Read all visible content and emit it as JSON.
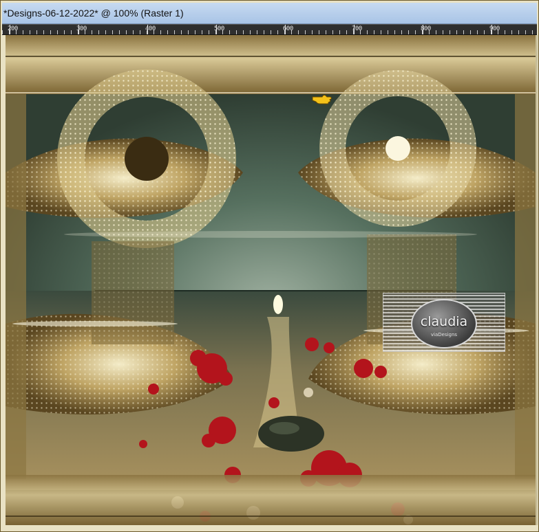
{
  "window": {
    "title": "*Designs-06-12-2022* @ 100% (Raster 1)"
  },
  "ruler": {
    "labels": [
      "200",
      "300",
      "400",
      "500",
      "600",
      "700",
      "800",
      "900"
    ]
  },
  "watermark": {
    "name": "claudia",
    "subtitle": "viaDesigns"
  },
  "colors": {
    "title_bar": "#b8d0ee",
    "ruler_bg": "#2e2e2e",
    "gold": "#c9b06a",
    "sea": "#4e6a5a",
    "flowers": "#b3141c"
  },
  "icons": {
    "pointer": "hand-pointer-icon"
  }
}
